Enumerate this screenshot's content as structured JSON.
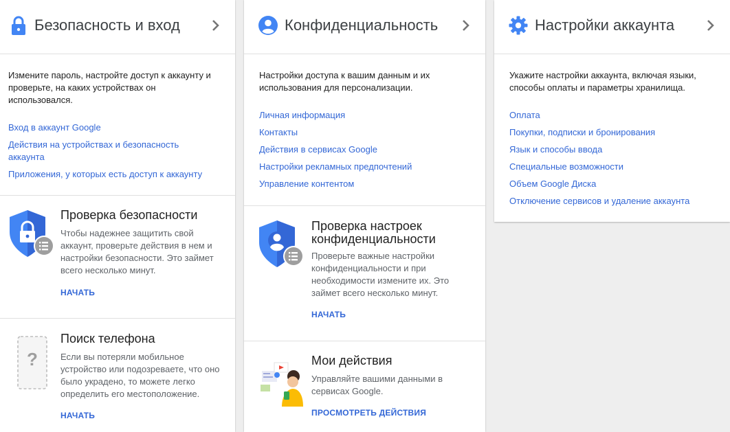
{
  "security": {
    "title": "Безопасность и вход",
    "description": "Измените пароль, настройте доступ к аккаунту и проверьте, на каких устройствах он использовался.",
    "links": [
      "Вход в аккаунт Google",
      "Действия на устройствах и безопасность аккаунта",
      "Приложения, у которых есть доступ к аккаунту"
    ],
    "checkup": {
      "title": "Проверка безопасности",
      "description": "Чтобы надежнее защитить свой аккаунт, проверьте действия в нем и настройки безопасности. Это займет всего несколько минут.",
      "action": "НАЧАТЬ"
    },
    "find_phone": {
      "title": "Поиск телефона",
      "description": "Если вы потеряли мобильное устройство или подозреваете, что оно было украдено, то можете легко определить его местоположение.",
      "action": "НАЧАТЬ"
    }
  },
  "privacy": {
    "title": "Конфиденциальность",
    "description": "Настройки доступа к вашим данным и их использования для персонализации.",
    "links": [
      "Личная информация",
      "Контакты",
      "Действия в сервисах Google",
      "Настройки рекламных предпочтений",
      "Управление контентом"
    ],
    "checkup": {
      "title": "Проверка настроек конфиденциальности",
      "description": "Проверьте важные настройки конфиденциальности и при необходимости измените их. Это займет всего несколько минут.",
      "action": "НАЧАТЬ"
    },
    "my_activity": {
      "title": "Мои действия",
      "description": "Управляйте вашими данными в сервисах Google.",
      "action": "ПРОСМОТРЕТЬ ДЕЙСТВИЯ"
    }
  },
  "account": {
    "title": "Настройки аккаунта",
    "description": "Укажите настройки аккаунта, включая языки, способы оплаты и параметры хранилища.",
    "links": [
      "Оплата",
      "Покупки, подписки и бронирования",
      "Язык и способы ввода",
      "Специальные возможности",
      "Объем Google Диска",
      "Отключение сервисов и удаление аккаунта"
    ]
  },
  "colors": {
    "accent": "#4285f4",
    "link": "#3367d6",
    "divider": "#e0e0e0",
    "background": "#eeeeee"
  },
  "icons": {
    "security": "lock-icon",
    "privacy": "person-icon",
    "account": "gear-icon",
    "chevron": "chevron-right-icon"
  }
}
